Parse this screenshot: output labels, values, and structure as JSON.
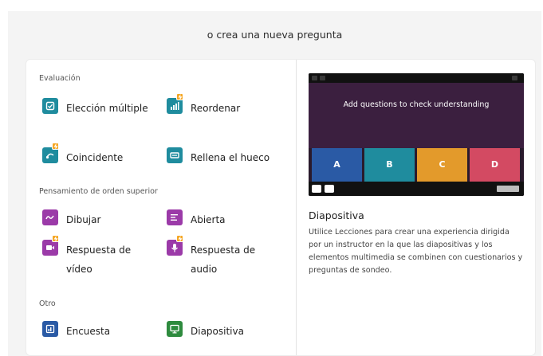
{
  "header": {
    "title": "o crea una nueva pregunta"
  },
  "sections": [
    {
      "label": "Evaluación",
      "items": [
        {
          "label": "Elección múltiple",
          "icon": "checkbox-icon",
          "color": "#1f8c9e",
          "badge": false
        },
        {
          "label": "Reordenar",
          "icon": "bar-chart-icon",
          "color": "#1f8c9e",
          "badge": true
        },
        {
          "label": "Coincidente",
          "icon": "match-icon",
          "color": "#1f8c9e",
          "badge": true
        },
        {
          "label": "Rellena el hueco",
          "icon": "blank-field-icon",
          "color": "#1f8c9e",
          "badge": false
        }
      ]
    },
    {
      "label": "Pensamiento de orden superior",
      "items": [
        {
          "label": "Dibujar",
          "icon": "draw-icon",
          "color": "#9b3aa8",
          "badge": false
        },
        {
          "label": "Abierta",
          "icon": "open-text-icon",
          "color": "#9b3aa8",
          "badge": false
        },
        {
          "label": "Respuesta de vídeo",
          "icon": "video-icon",
          "color": "#9b3aa8",
          "badge": true
        },
        {
          "label": "Respuesta de audio",
          "icon": "microphone-icon",
          "color": "#9b3aa8",
          "badge": true
        }
      ]
    },
    {
      "label": "Otro",
      "items": [
        {
          "label": "Encuesta",
          "icon": "poll-icon",
          "color": "#2a5aa5",
          "badge": false
        },
        {
          "label": "Diapositiva",
          "icon": "slide-icon",
          "color": "#2e8b3e",
          "badge": false
        }
      ]
    }
  ],
  "preview": {
    "question": "Add questions to check understanding",
    "tiles": [
      {
        "label": "A",
        "color": "#2a5aa5"
      },
      {
        "label": "B",
        "color": "#1f8c9e"
      },
      {
        "label": "C",
        "color": "#e39a2b"
      },
      {
        "label": "D",
        "color": "#d34a62"
      }
    ],
    "frame_color": "#3b1f3f"
  },
  "description": {
    "title": "Diapositiva",
    "body": "Utilice Lecciones para crear una experiencia dirigida por un instructor en la que las diapositivas y los elementos multimedia se combinen con cuestionarios y preguntas de sondeo."
  },
  "badge_icon": "lightning-icon"
}
